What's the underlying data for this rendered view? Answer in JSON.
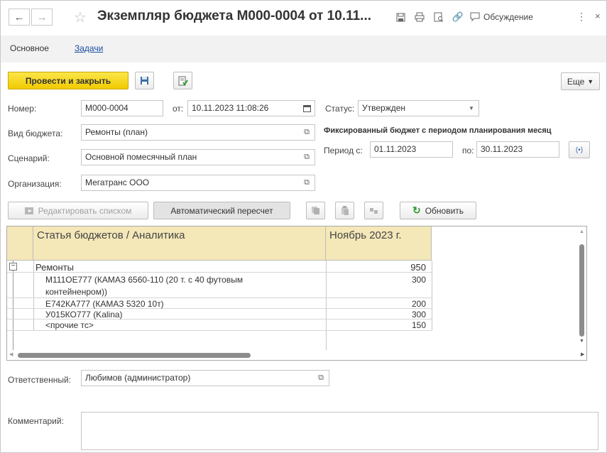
{
  "window": {
    "title": "Экземпляр бюджета М000-0004 от 10.11...",
    "discussion_label": "Обсуждение"
  },
  "tabs": [
    {
      "label": "Основное"
    },
    {
      "label": "Задачи"
    }
  ],
  "toolbar": {
    "post_close_label": "Провести и закрыть",
    "more_label": "Еще"
  },
  "form": {
    "number_label": "Номер:",
    "number_value": "М000-0004",
    "from_label": "от:",
    "date_value": "10.11.2023 11:08:26",
    "status_label": "Статус:",
    "status_value": "Утвержден",
    "budget_type_label": "Вид бюджета:",
    "budget_type_value": "Ремонты (план)",
    "fixed_note": "Фиксированный бюджет с периодом планирования месяц",
    "scenario_label": "Сценарий:",
    "scenario_value": "Основной помесячный план",
    "period_from_label": "Период с:",
    "period_from_value": "01.11.2023",
    "period_to_label": "по:",
    "period_to_value": "30.11.2023",
    "org_label": "Организация:",
    "org_value": "Мегатранс ООО"
  },
  "grid_toolbar": {
    "edit_list_label": "Редактировать списком",
    "auto_recalc_label": "Автоматический пересчет",
    "refresh_label": "Обновить"
  },
  "grid": {
    "col1_header": "Статья бюджетов / Аналитика",
    "col2_header": "Ноябрь 2023 г.",
    "rows": [
      {
        "label": "Ремонты",
        "value": "950"
      },
      {
        "label": "М111ОЕ777 (КАМАЗ 6560-110 (20 т. с 40 футовым",
        "label2": "контейненром))",
        "value": "300"
      },
      {
        "label": "Е742КА777 (КАМАЗ 5320 10т)",
        "value": "200"
      },
      {
        "label": "У015КО777 (Kalina)",
        "value": "300"
      },
      {
        "label": "<прочие тс>",
        "value": "150"
      }
    ]
  },
  "footer": {
    "responsible_label": "Ответственный:",
    "responsible_value": "Любимов (администратор)",
    "comment_label": "Комментарий:",
    "comment_value": ""
  },
  "colors": {
    "primary_button": "#f5d000",
    "grid_header": "#f4e7b8",
    "link": "#1a4da0"
  }
}
